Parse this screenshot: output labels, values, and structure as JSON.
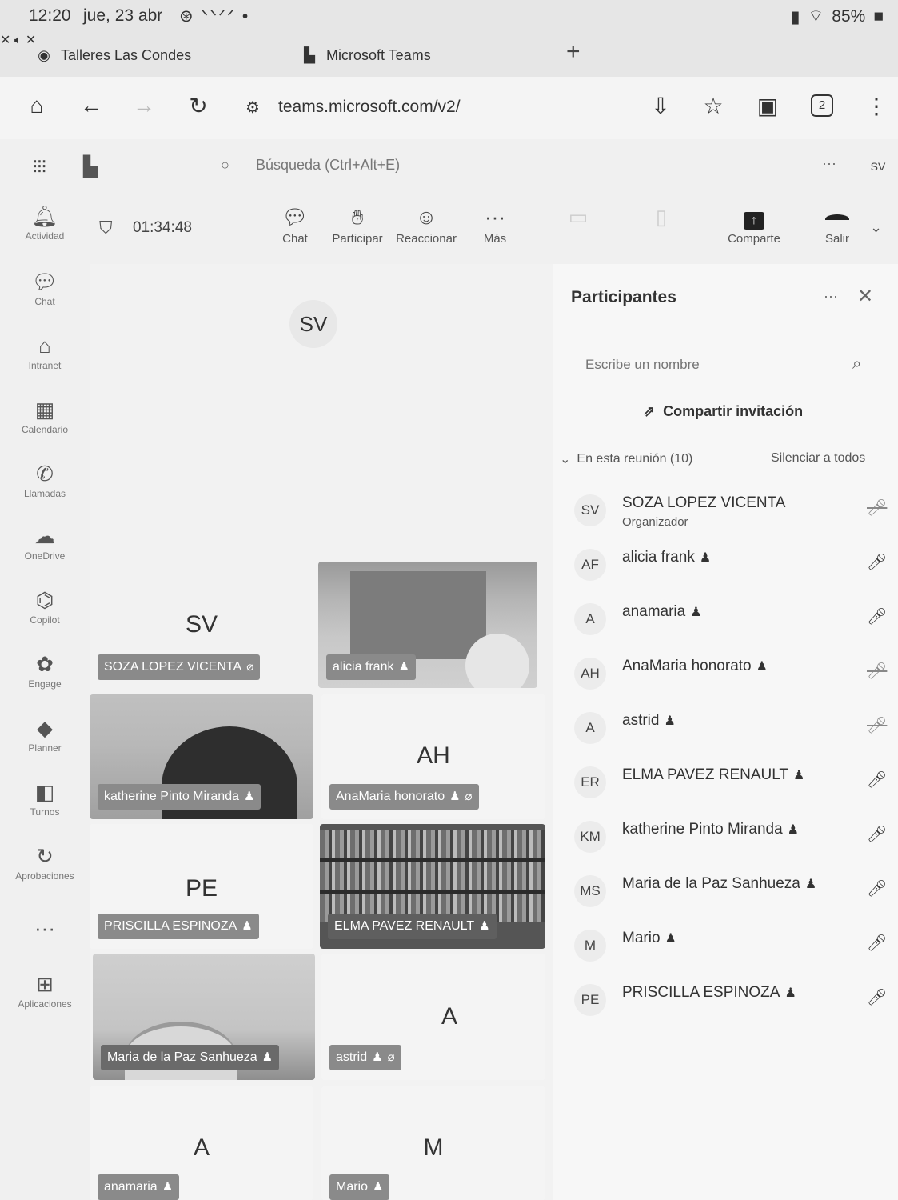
{
  "status_bar": {
    "time": "12:20",
    "date": "jue, 23 abr",
    "sys_icons": "⊛ ᐠᐠᐟᐟ •",
    "battery": "85%"
  },
  "tabs": [
    {
      "title": "Talleres Las Condes"
    },
    {
      "title": "Microsoft Teams"
    }
  ],
  "address_bar": {
    "url": "teams.microsoft.com/v2/",
    "tab_count": "2"
  },
  "teams_header": {
    "search_placeholder": "Búsqueda (Ctrl+Alt+E)",
    "avatar": "SV"
  },
  "rail": [
    {
      "label": "Actividad",
      "icon": "bell-icon"
    },
    {
      "label": "Chat",
      "icon": "chat-icon"
    },
    {
      "label": "Intranet",
      "icon": "home-icon"
    },
    {
      "label": "Calendario",
      "icon": "calendar-icon"
    },
    {
      "label": "Llamadas",
      "icon": "phone-icon"
    },
    {
      "label": "OneDrive",
      "icon": "cloud-icon"
    },
    {
      "label": "Copilot",
      "icon": "copilot-icon"
    },
    {
      "label": "Engage",
      "icon": "engage-icon"
    },
    {
      "label": "Planner",
      "icon": "planner-icon"
    },
    {
      "label": "Turnos",
      "icon": "shifts-icon"
    },
    {
      "label": "Aprobaciones",
      "icon": "approvals-icon"
    },
    {
      "label": "",
      "icon": "more-icon"
    },
    {
      "label": "Aplicaciones",
      "icon": "apps-icon"
    }
  ],
  "meeting": {
    "timer": "01:34:48",
    "toolbar": {
      "chat": "Chat",
      "raise": "Participar",
      "react": "Reaccionar",
      "more": "Más",
      "share": "Comparte",
      "leave": "Salir"
    },
    "presenter_initials": "SV",
    "tiles": [
      {
        "name": "SOZA LOPEZ VICENTA",
        "initials": "SV",
        "muted": true
      },
      {
        "name": "alicia frank",
        "initials": ""
      },
      {
        "name": "katherine Pinto Miranda",
        "initials": ""
      },
      {
        "name": "AnaMaria honorato",
        "initials": "AH",
        "muted": true
      },
      {
        "name": "PRISCILLA ESPINOZA",
        "initials": "PE"
      },
      {
        "name": "ELMA PAVEZ RENAULT",
        "initials": ""
      },
      {
        "name": "Maria de la Paz Sanhueza",
        "initials": ""
      },
      {
        "name": "astrid",
        "initials": "A",
        "muted": true
      },
      {
        "name": "anamaria",
        "initials": "A"
      },
      {
        "name": "Mario",
        "initials": "M"
      }
    ]
  },
  "participants_panel": {
    "title": "Participantes",
    "search_placeholder": "Escribe un nombre",
    "invite": "Compartir invitación",
    "section": "En esta reunión (10)",
    "mute_all": "Silenciar a todos",
    "people": [
      {
        "initials": "SV",
        "name": "SOZA LOPEZ VICENTA",
        "role": "Organizador",
        "mic": "off"
      },
      {
        "initials": "AF",
        "name": "alicia frank",
        "role": "",
        "mic": "on"
      },
      {
        "initials": "A",
        "name": "anamaria",
        "role": "",
        "mic": "on"
      },
      {
        "initials": "AH",
        "name": "AnaMaria honorato",
        "role": "",
        "mic": "off"
      },
      {
        "initials": "A",
        "name": "astrid",
        "role": "",
        "mic": "off"
      },
      {
        "initials": "ER",
        "name": "ELMA PAVEZ RENAULT",
        "role": "",
        "mic": "on"
      },
      {
        "initials": "KM",
        "name": "katherine Pinto Miranda",
        "role": "",
        "mic": "on"
      },
      {
        "initials": "MS",
        "name": "Maria de la Paz Sanhueza",
        "role": "",
        "mic": "on"
      },
      {
        "initials": "M",
        "name": "Mario",
        "role": "",
        "mic": "on"
      },
      {
        "initials": "PE",
        "name": "PRISCILLA ESPINOZA",
        "role": "",
        "mic": "on"
      }
    ]
  }
}
